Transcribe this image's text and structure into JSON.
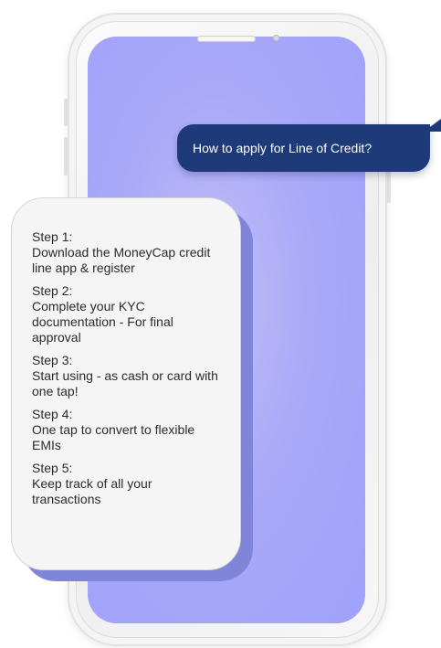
{
  "chat": {
    "question": "How to apply for Line of Credit?",
    "steps": [
      {
        "title": "Step 1:",
        "text": "Download the MoneyCap credit line app & register"
      },
      {
        "title": "Step 2:",
        "text": "Complete your KYC documentation - For final approval"
      },
      {
        "title": "Step 3:",
        "text": "Start using - as cash or card with one tap!"
      },
      {
        "title": "Step 4:",
        "text": "One tap to convert to flexible EMIs"
      },
      {
        "title": "Step 5:",
        "text": "Keep track of all your transactions"
      }
    ]
  },
  "colors": {
    "question_bubble": "#1f3a78",
    "answer_bubble": "#f5f5f5",
    "answer_shadow": "#7f85d9",
    "screen": "#aaa9f8"
  },
  "icons": [
    "speaker-grille",
    "front-camera"
  ]
}
